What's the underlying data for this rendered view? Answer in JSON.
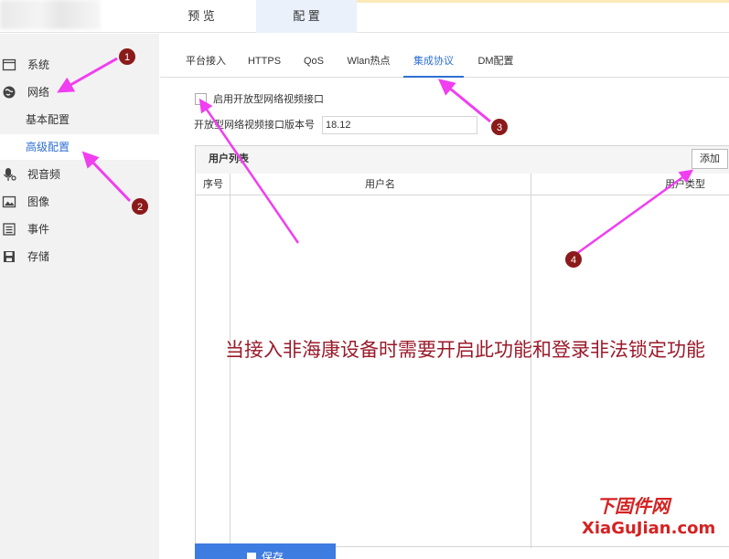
{
  "top_tabs": [
    {
      "label": "预 览"
    },
    {
      "label": "配 置"
    }
  ],
  "sidebar": {
    "items": [
      {
        "label": "系统",
        "icon": "window-icon"
      },
      {
        "label": "网络",
        "icon": "globe-icon"
      },
      {
        "label": "视音频",
        "icon": "microphone-icon"
      },
      {
        "label": "图像",
        "icon": "image-icon"
      },
      {
        "label": "事件",
        "icon": "list-icon"
      },
      {
        "label": "存储",
        "icon": "floppy-icon"
      }
    ],
    "sub_items": [
      {
        "label": "基本配置"
      },
      {
        "label": "高级配置",
        "active": true
      }
    ]
  },
  "subtabs": [
    {
      "label": "平台接入"
    },
    {
      "label": "HTTPS"
    },
    {
      "label": "QoS"
    },
    {
      "label": "Wlan热点"
    },
    {
      "label": "集成协议",
      "active": true
    },
    {
      "label": "DM配置"
    }
  ],
  "form": {
    "enable_label": "启用开放型网络视频接口",
    "enabled": false,
    "version_label": "开放型网络视频接口版本号",
    "version_value": "18.12"
  },
  "user_list": {
    "title": "用户列表",
    "add_label": "添加",
    "columns": [
      "序号",
      "用户名",
      "用户类型"
    ],
    "rows": []
  },
  "save_label": "保存",
  "annotations": {
    "markers": [
      "1",
      "2",
      "3",
      "4"
    ],
    "note": "当接入非海康设备时需要开启此功能和登录非法锁定功能",
    "arrow_color": "#f03ef0",
    "marker_color": "#8b1a1a"
  },
  "watermark": {
    "cn": "下固件网",
    "en": "XiaGuJian.com"
  },
  "colors": {
    "accent": "#2f6fd2",
    "save_button": "#3d7ce0",
    "sidebar_bg": "#f2f2f2"
  }
}
